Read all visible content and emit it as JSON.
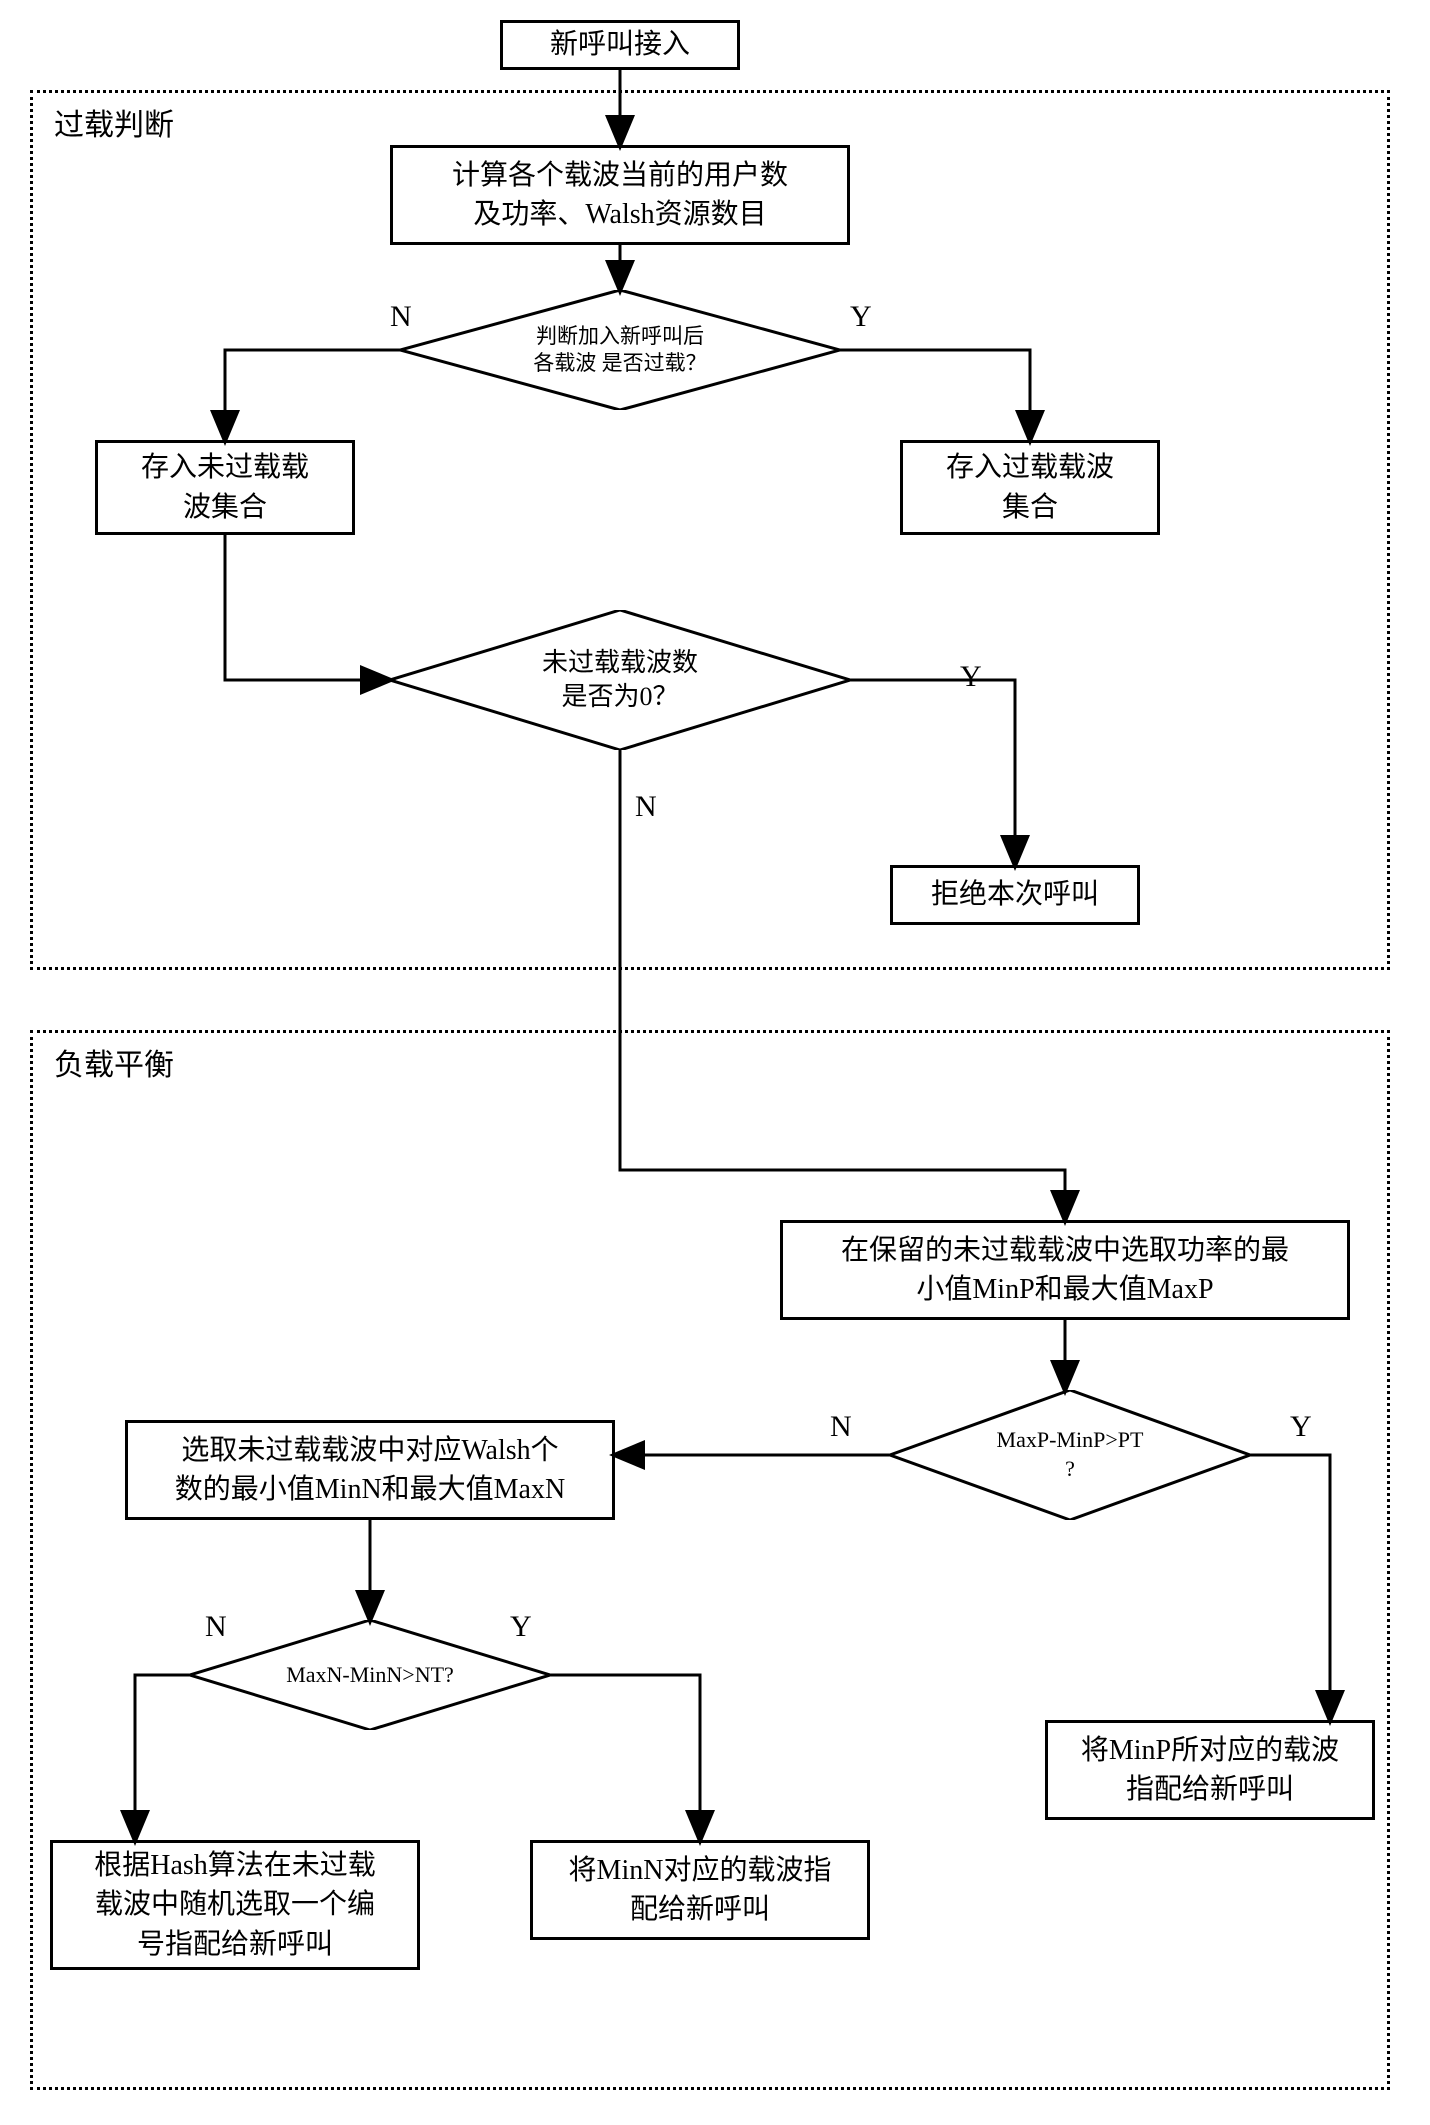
{
  "start": "新呼叫接入",
  "group1_label": "过载判断",
  "group2_label": "负载平衡",
  "calc": "计算各个载波当前的用户数\n及功率、Walsh资源数目",
  "dec_overload": "判断加入新呼叫后\n各载波 是否过载？",
  "store_not_overload": "存入未过载载\n波集合",
  "store_overload": "存入过载载波\n集合",
  "dec_zero": "未过载载波数\n是否为0？",
  "reject": "拒绝本次呼叫",
  "select_power": "在保留的未过载载波中选取功率的最\n小值MinP和最大值MaxP",
  "dec_power": "MaxP-MinP>PT\n?",
  "assign_minp": "将MinP所对应的载波\n指配给新呼叫",
  "select_walsh": "选取未过载载波中对应Walsh个\n数的最小值MinN和最大值MaxN",
  "dec_walsh": "MaxN-MinN>NT?",
  "assign_minn": "将MinN对应的载波指\n配给新呼叫",
  "hash": "根据Hash算法在未过载\n载波中随机选取一个编\n号指配给新呼叫",
  "yes": "Y",
  "no": "N"
}
